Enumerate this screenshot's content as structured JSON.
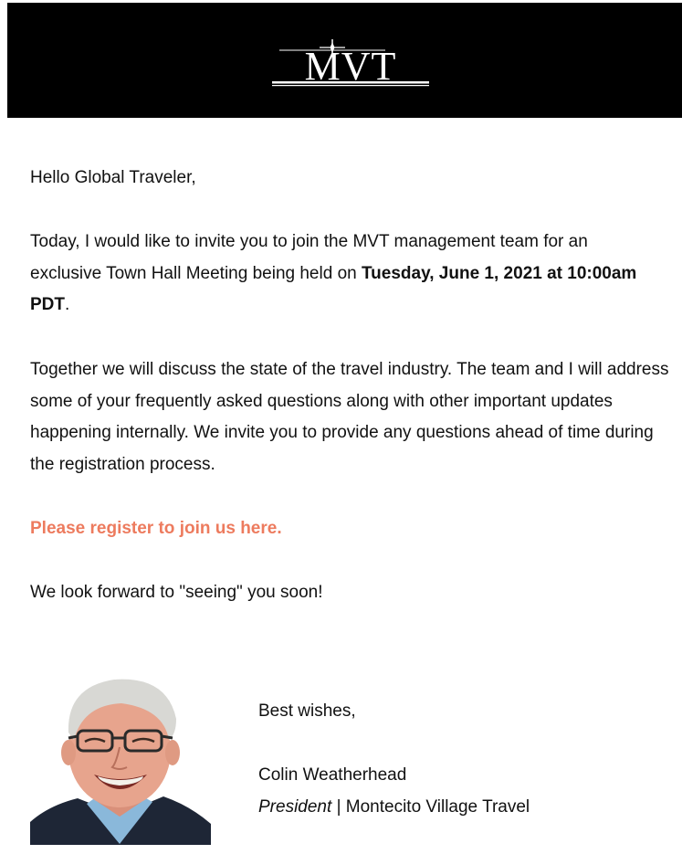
{
  "header": {
    "logo_text": "MVT",
    "colors": {
      "background": "#000000",
      "logo": "#ffffff"
    }
  },
  "body": {
    "greeting": "Hello Global Traveler,",
    "invite_text": "Today, I would like to invite you to join the MVT management team for an exclusive Town Hall Meeting being held on",
    "invite_bold": "Tuesday, June 1, 2021 at 10:00am PDT",
    "invite_end": ".",
    "together_text": "Together we will discuss the state of the travel industry. The team and I will address some of your frequently asked questions along with other important updates happening internally. We invite you to provide any questions ahead of time during the registration process.",
    "register_link": "Please register to join us here.",
    "look_forward": "We look forward to \"seeing\" you soon!",
    "colors": {
      "link": "#ed7b5e",
      "text": "#111111"
    }
  },
  "signature": {
    "closing": "Best wishes,",
    "name": "Colin Weatherhead",
    "title_italic": "President",
    "separator": "|",
    "company": "Montecito Village Travel"
  }
}
